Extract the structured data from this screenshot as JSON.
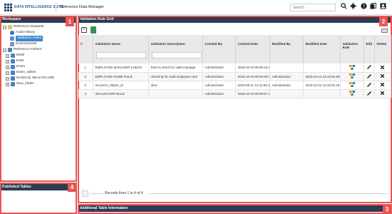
{
  "header": {
    "brand": "DATA INTELLIGENCE SUITE",
    "module": "Reference Data Manager",
    "search_placeholder": "Search",
    "icons": [
      "search-icon",
      "gear-icon",
      "help-icon",
      "documents-icon",
      "user-icon"
    ]
  },
  "workspace": {
    "title": "Workspace",
    "tree": [
      {
        "label": "Reference Datasets",
        "icon": "folder-icon",
        "level": 0,
        "expander": "−"
      },
      {
        "label": "Audit History",
        "icon": "history-icon",
        "level": 1
      },
      {
        "label": "Validation Rules",
        "icon": "rule-icon",
        "level": 1,
        "selected": true
      },
      {
        "label": "Environments",
        "icon": "environment-icon",
        "level": 1
      },
      {
        "label": "Reference Folders",
        "icon": "folder-users-icon",
        "level": 0,
        "expander": "−"
      },
      {
        "label": "EDW",
        "icon": "user-folder-icon",
        "level": 1,
        "expander": "+"
      },
      {
        "label": "EON",
        "icon": "user-folder-icon",
        "level": 1,
        "expander": "+"
      },
      {
        "label": "Erwin",
        "icon": "user-folder-icon",
        "level": 1,
        "expander": "+"
      },
      {
        "label": "Erwin_tables",
        "icon": "user-folder-icon",
        "level": 1,
        "expander": "+"
      },
      {
        "label": "NASDAQ HEALTHCARE",
        "icon": "user-folder-icon",
        "level": 1,
        "expander": "+"
      },
      {
        "label": "New_folder",
        "icon": "user-folder-icon",
        "level": 1,
        "expander": "+"
      }
    ]
  },
  "grid": {
    "title": "Validation Rule Grid",
    "columns": [
      "#",
      "Validation Name",
      "Validation Description",
      "Created By",
      "Created Date",
      "Modified By",
      "Modified Date",
      "Validation Rule",
      "Edit",
      "Delete"
    ],
    "rows": [
      {
        "num": "1",
        "name": "EMPLOYEE MANAGER CHECK",
        "desc": "Rule to check for valid manager",
        "created_by": "Administrator",
        "created_date": "2018-10-19 09:05:10.61",
        "modified_by": "",
        "modified_date": ""
      },
      {
        "num": "2",
        "name": "EMPLOYEE NAME RULE",
        "desc": "checking for valid employee nam",
        "created_by": "Administrator",
        "created_date": "2018-10-19 09:05:40.04",
        "modified_by": "Administrator",
        "modified_date": "2019-03-13 22:43:50.60"
      },
      {
        "num": "3",
        "name": "Incorrect_Object_id",
        "desc": "desc",
        "created_by": "Administrator",
        "created_date": "2019-09-11 14:11:59.4",
        "modified_by": "Administrator",
        "modified_date": "2019-11-01 13:19:02.19"
      },
      {
        "num": "4",
        "name": "INVALID EMP RULE",
        "desc": "",
        "created_by": "Administrator",
        "created_date": "2018-10-19 09:05:57.25",
        "modified_by": "",
        "modified_date": ""
      }
    ],
    "footer": "Records from 1 to 4 of 4"
  },
  "bottom": {
    "left_title": "Published Tables",
    "right_title": "Additional Table Information"
  },
  "markers": [
    "1",
    "2",
    "3",
    "4"
  ],
  "colors": {
    "header_bg": "#2d3c52",
    "marker_red": "#ea5455",
    "brand_blue": "#1f5f9e",
    "selected_blue": "#3f86d1"
  }
}
